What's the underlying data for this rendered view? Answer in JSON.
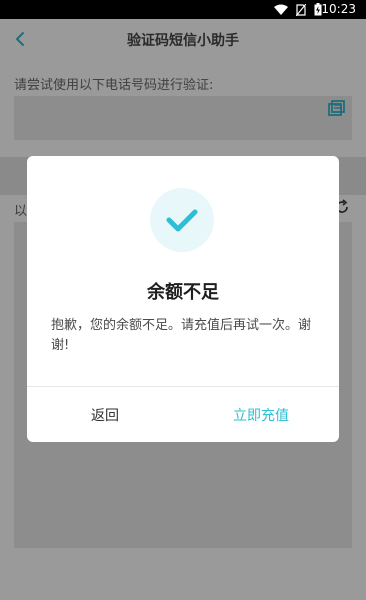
{
  "status_bar": {
    "time": "10:23",
    "icons": [
      "wifi-icon",
      "no-sim-icon",
      "battery-charging-icon"
    ]
  },
  "header": {
    "title": "验证码短信小助手",
    "back_icon": "chevron-left-icon"
  },
  "main": {
    "prompt": "请尝试使用以下电话号码进行验证:",
    "copy_icon": "copy-icon",
    "lower_label": "以",
    "refresh_icon": "refresh-icon"
  },
  "dialog": {
    "icon": "check-icon",
    "title": "余额不足",
    "message": "抱歉，您的余额不足。请充值后再试一次。谢谢!",
    "buttons": {
      "back": "返回",
      "recharge": "立即充值"
    }
  },
  "colors": {
    "accent": "#2bbfd6",
    "dim_overlay": "#9a9a9a",
    "dialog_bg": "#ffffff"
  }
}
